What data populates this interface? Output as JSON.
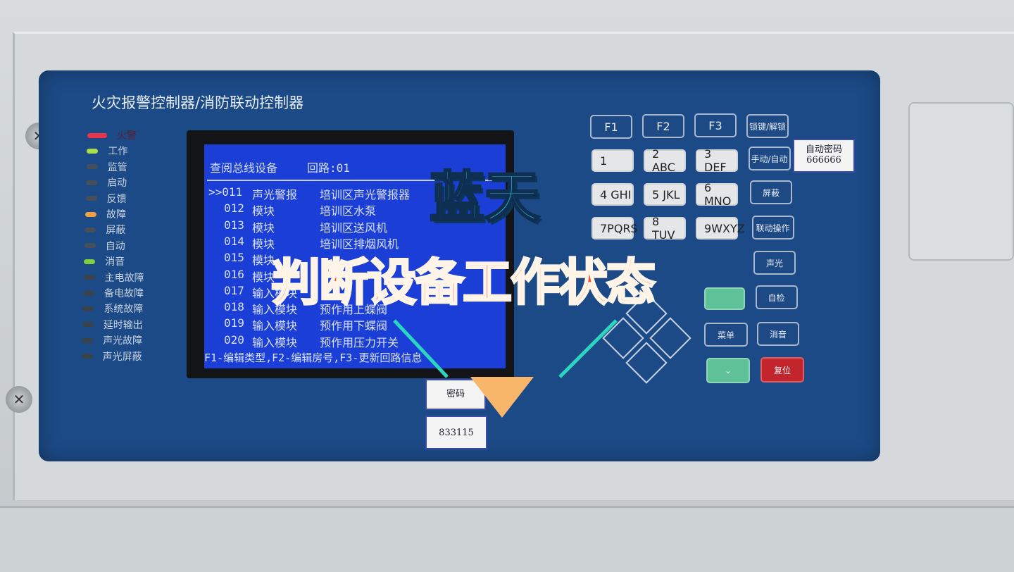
{
  "panel_title": "火灾报警控制器/消防联动控制器",
  "indicators": [
    {
      "label": "火警",
      "color": "#e8344a"
    },
    {
      "label": "工作",
      "color": "#a6e04a"
    },
    {
      "label": "监管",
      "color": "#47505a"
    },
    {
      "label": "启动",
      "color": "#47505a"
    },
    {
      "label": "反馈",
      "color": "#47505a"
    },
    {
      "label": "故障",
      "color": "#f0a040"
    },
    {
      "label": "屏蔽",
      "color": "#47505a"
    },
    {
      "label": "自动",
      "color": "#47505a"
    },
    {
      "label": "消音",
      "color": "#7ed040"
    },
    {
      "label": "主电故障",
      "color": "#3a424b"
    },
    {
      "label": "备电故障",
      "color": "#3a424b"
    },
    {
      "label": "系统故障",
      "color": "#3a424b"
    },
    {
      "label": "延时输出",
      "color": "#3a424b"
    },
    {
      "label": "声光故障",
      "color": "#3a424b"
    },
    {
      "label": "声光屏蔽",
      "color": "#3a424b"
    }
  ],
  "lcd": {
    "title": "查阅总线设备",
    "loop": "回路:01",
    "rows": [
      {
        "num": ">>011",
        "type": "声光警报",
        "location": "培训区声光警报器"
      },
      {
        "num": "012",
        "type": "模块",
        "location": "培训区水泵"
      },
      {
        "num": "013",
        "type": "模块",
        "location": "培训区送风机"
      },
      {
        "num": "014",
        "type": "模块",
        "location": "培训区排烟风机"
      },
      {
        "num": "015",
        "type": "模块",
        "location": ""
      },
      {
        "num": "016",
        "type": "模块",
        "location": ""
      },
      {
        "num": "017",
        "type": "输入模块",
        "location": ""
      },
      {
        "num": "018",
        "type": "输入模块",
        "location": "预作用上蝶阀"
      },
      {
        "num": "019",
        "type": "输入模块",
        "location": "预作用下蝶阀"
      },
      {
        "num": "020",
        "type": "输入模块",
        "location": "预作用压力开关"
      }
    ],
    "footer": "F1-编辑类型,F2-编辑房号,F3-更新回路信息"
  },
  "keypad": {
    "f": [
      "F1",
      "F2",
      "F3"
    ],
    "digits": [
      "1",
      "2 ABC",
      "3 DEF",
      "4 GHI",
      "5 JKL",
      "6 MNO",
      "7PQRS",
      "8 TUV",
      "9WXYZ"
    ],
    "side": [
      "锁键/解锁",
      "手动/自动",
      "屏蔽",
      "联动操作",
      "声光",
      "自检",
      "消音"
    ],
    "menu": "菜单",
    "reset": "复位"
  },
  "notes": {
    "auto_password_label": "自动密码",
    "auto_password": "666666",
    "password_label": "密码",
    "password": "833115"
  },
  "overlay": {
    "brand": "蓝天",
    "caption": "判断设备工作状态"
  }
}
